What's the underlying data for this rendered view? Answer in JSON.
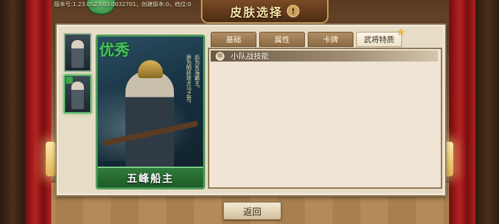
{
  "header": {
    "title": "皮肤选择",
    "info_symbol": "!",
    "version_text": "版本号:1.23.0523.03.0032701，创建版本:0，档位:0"
  },
  "thumbnails": [
    {
      "label": "thumb-1",
      "selected": false
    },
    {
      "label": "thumb-2",
      "selected": true
    }
  ],
  "card": {
    "rarity_label": "优秀",
    "name": "五峰船主",
    "vertical_text_a": "原为明廷效犬马之劳，",
    "vertical_text_b": "后为东海霸主。"
  },
  "tabs": [
    {
      "label": "基础",
      "active": false
    },
    {
      "label": "属性",
      "active": false
    },
    {
      "label": "卡牌",
      "active": false
    },
    {
      "label": "武将特质",
      "active": true,
      "star": "★"
    }
  ],
  "skill": {
    "icon_text": "明",
    "title": "小队战技能"
  },
  "footer": {
    "return_label": "返回"
  },
  "colors": {
    "accent_green": "#4d9c58",
    "gold": "#caa25e",
    "curtain_red": "#b52222"
  }
}
